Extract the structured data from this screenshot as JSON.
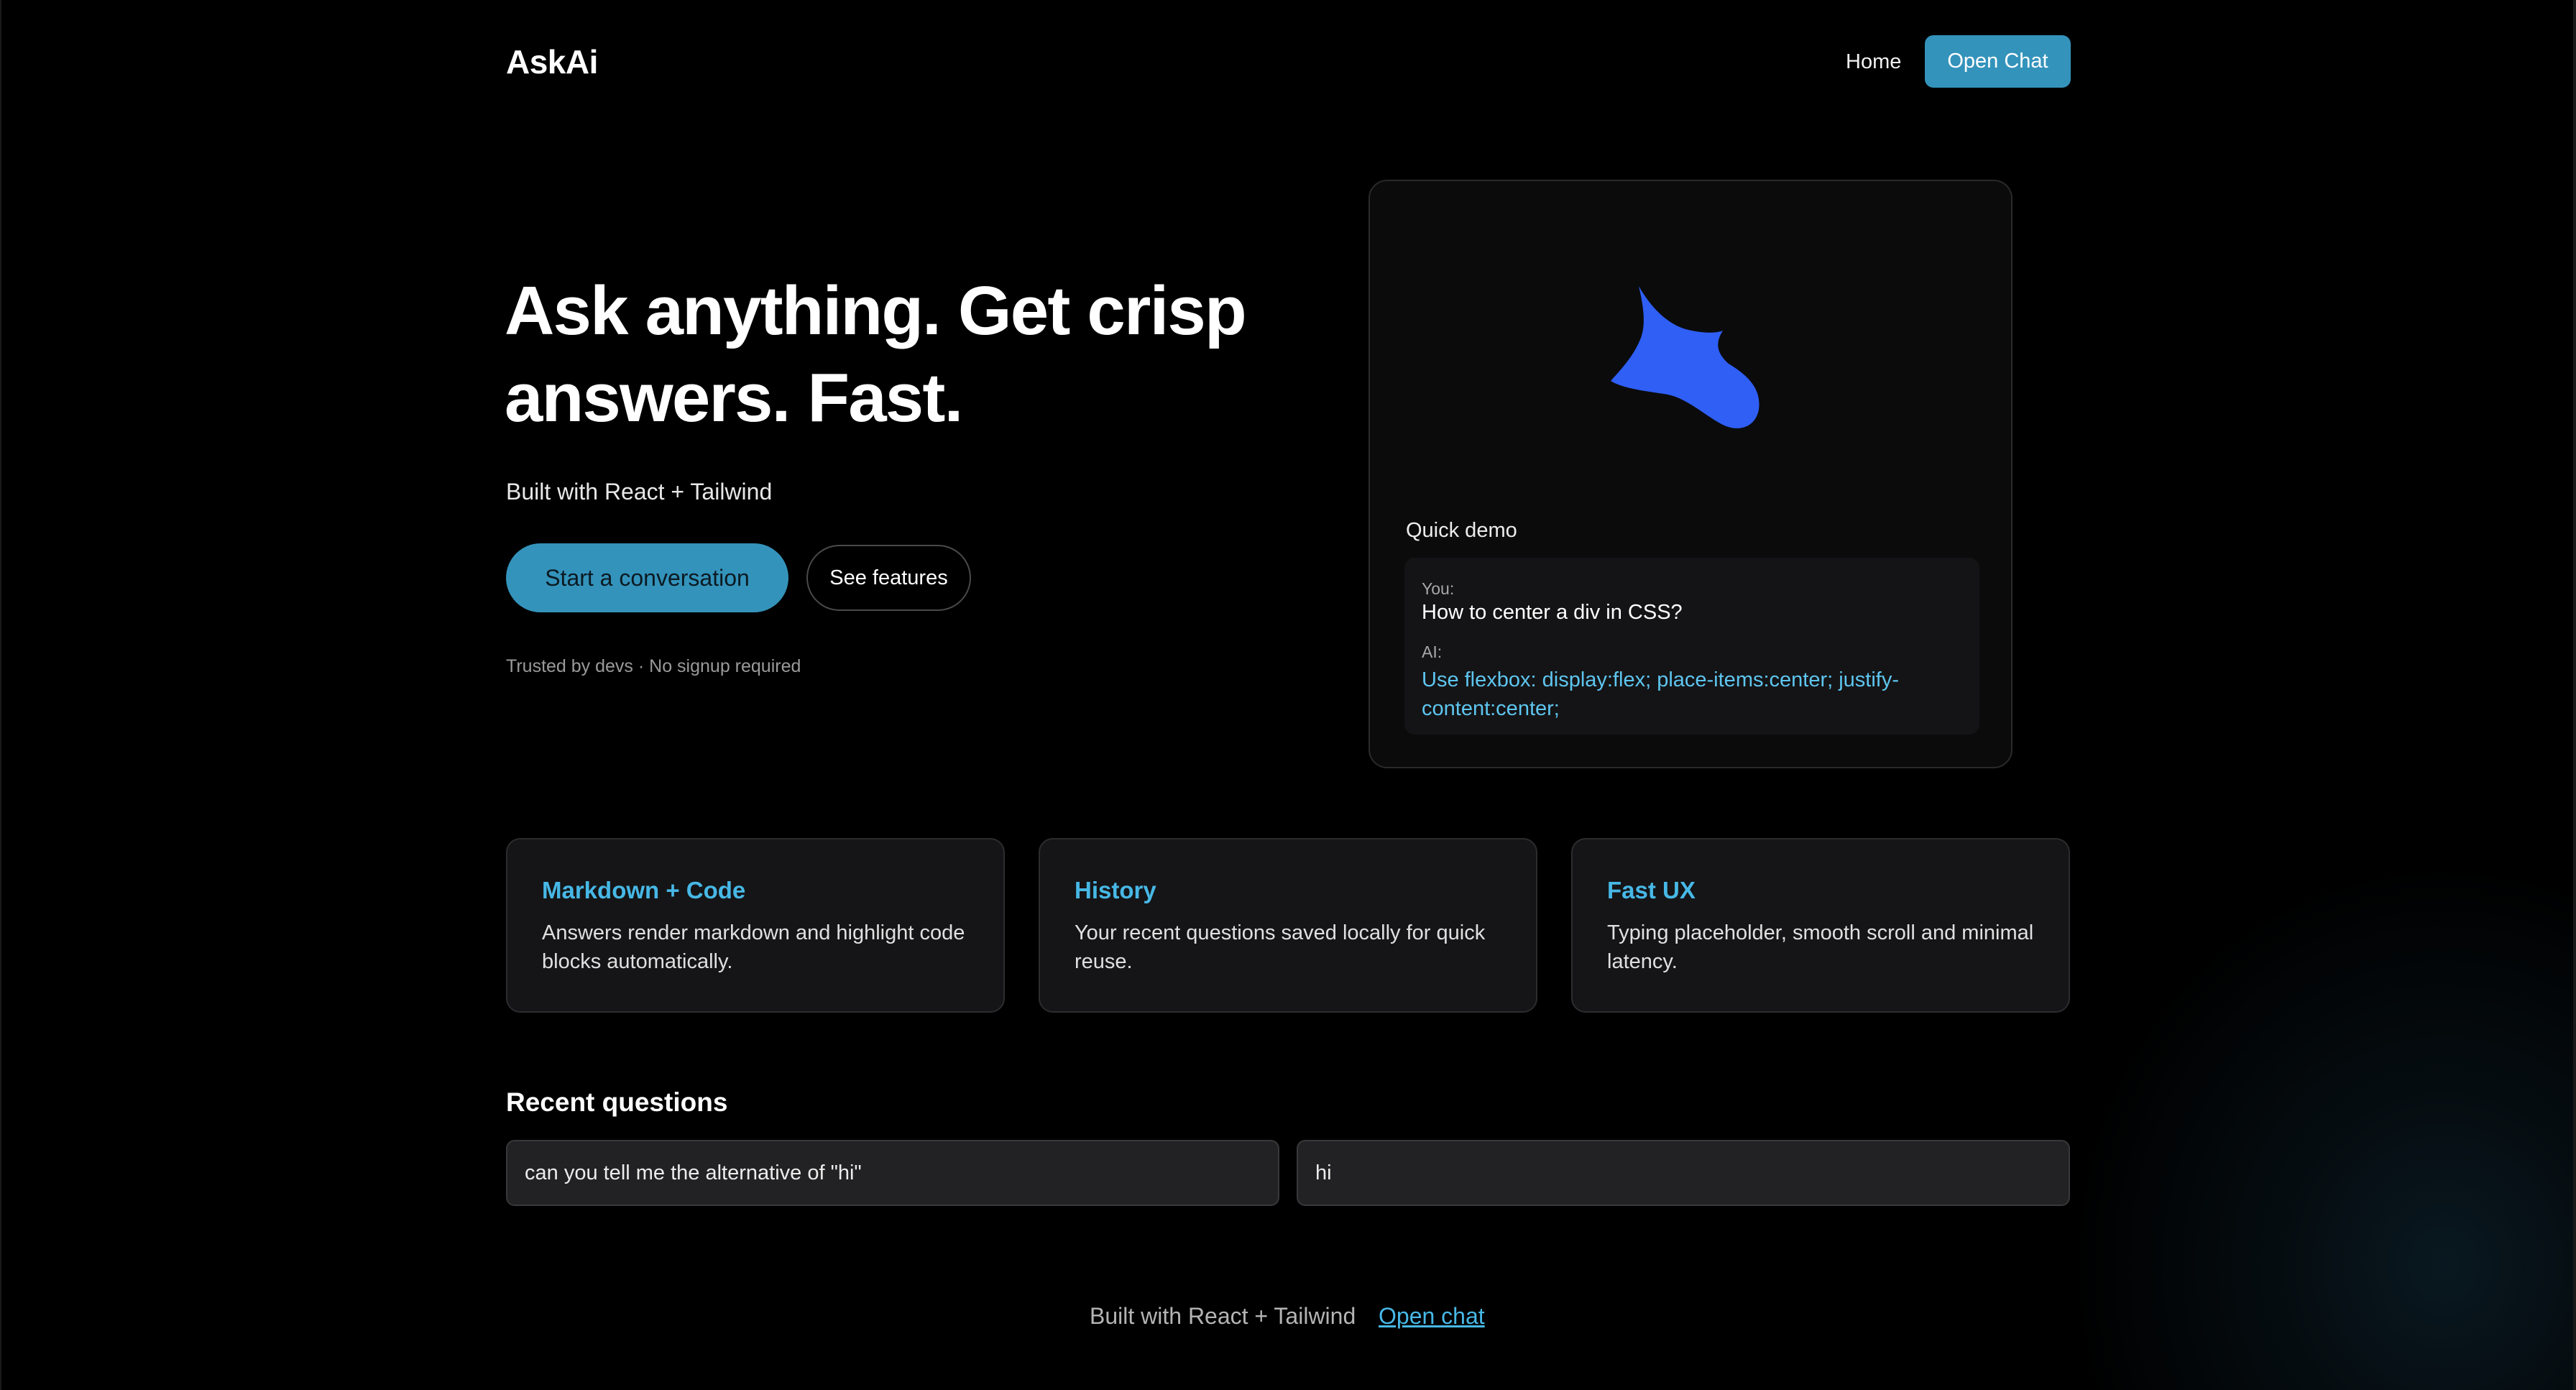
{
  "header": {
    "logo": "AskAi",
    "nav_home": "Home",
    "nav_open_chat": "Open Chat"
  },
  "hero": {
    "title_line1": "Ask anything. Get crisp",
    "title_line2": "answers. Fast.",
    "subtitle": "Built with React + Tailwind",
    "primary_button": "Start a conversation",
    "secondary_button": "See features",
    "trusted_note": "Trusted by devs · No signup required"
  },
  "demo": {
    "logo_icon": "blue-star-blob-icon",
    "label": "Quick demo",
    "you_label": "You:",
    "question": "How to center a div in CSS?",
    "ai_label": "AI:",
    "answer": "Use flexbox: display:flex; place-items:center; justify-content:center;"
  },
  "features": [
    {
      "title": "Markdown + Code",
      "description": "Answers render markdown and highlight code blocks automatically."
    },
    {
      "title": "History",
      "description": "Your recent questions saved locally for quick reuse."
    },
    {
      "title": "Fast UX",
      "description": "Typing placeholder, smooth scroll and minimal latency."
    }
  ],
  "recent": {
    "heading": "Recent questions",
    "items": [
      "can you tell me the alternative of \"hi\"",
      "hi"
    ]
  },
  "footer": {
    "text": "Built with React + Tailwind",
    "link": "Open chat"
  },
  "colors": {
    "accent": "#3493bb",
    "feature_title": "#47b8e6",
    "demo_answer": "#5ec6f0",
    "logo_blob": "#2f5ff5",
    "background": "#000000"
  }
}
